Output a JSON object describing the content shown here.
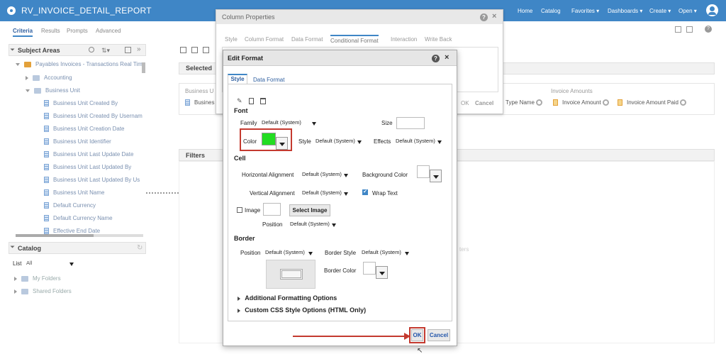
{
  "app": {
    "title": "RV_INVOICE_DETAIL_REPORT"
  },
  "nav": {
    "home": "Home",
    "catalog": "Catalog",
    "favorites": "Favorites",
    "dashboards": "Dashboards",
    "create": "Create",
    "open": "Open"
  },
  "tabs": [
    "Criteria",
    "Results",
    "Prompts",
    "Advanced"
  ],
  "subject_areas": {
    "title": "Subject Areas",
    "root": "Payables Invoices - Transactions Real Tim",
    "items": [
      {
        "label": "Accounting",
        "type": "folder"
      },
      {
        "label": "Business Unit",
        "type": "folder-open"
      },
      {
        "label": "Business Unit Created By",
        "type": "column"
      },
      {
        "label": "Business Unit Created By Usernam",
        "type": "column"
      },
      {
        "label": "Business Unit Creation Date",
        "type": "column"
      },
      {
        "label": "Business Unit Identifier",
        "type": "column"
      },
      {
        "label": "Business Unit Last Update Date",
        "type": "column"
      },
      {
        "label": "Business Unit Last Updated By",
        "type": "column"
      },
      {
        "label": "Business Unit Last Updated By Us",
        "type": "column"
      },
      {
        "label": "Business Unit Name",
        "type": "column"
      },
      {
        "label": "Default Currency",
        "type": "column"
      },
      {
        "label": "Default Currency Name",
        "type": "column"
      },
      {
        "label": "Effective End Date",
        "type": "column"
      }
    ]
  },
  "catalog": {
    "title": "Catalog",
    "list_label": "List",
    "list_value": "All",
    "folders": [
      "My Folders",
      "Shared Folders"
    ]
  },
  "selected_columns": {
    "title": "Selected",
    "group_left": "Business U",
    "pill_left": "Busines",
    "group_right": "Invoice Amounts",
    "pills": [
      "Type Name",
      "Invoice Amount",
      "Invoice Amount Paid"
    ]
  },
  "filters": {
    "title": "Filters",
    "hint_fragment": "ters"
  },
  "column_properties": {
    "title": "Column Properties",
    "tabs": [
      "Style",
      "Column Format",
      "Data Format",
      "Conditional Format",
      "Interaction",
      "Write Back"
    ],
    "active_tab": "Conditional Format",
    "ok": "OK",
    "cancel": "Cancel"
  },
  "edit_format": {
    "title": "Edit Format",
    "tabs": [
      "Style",
      "Data Format"
    ],
    "font": {
      "section": "Font",
      "family_label": "Family",
      "family_value": "Default (System)",
      "size_label": "Size",
      "color_label": "Color",
      "color_value": "#22dd22",
      "style_label": "Style",
      "style_value": "Default (System)",
      "effects_label": "Effects",
      "effects_value": "Default (System)"
    },
    "cell": {
      "section": "Cell",
      "halign_label": "Horizontal Alignment",
      "halign_value": "Default (System)",
      "bg_label": "Background Color",
      "valign_label": "Vertical Alignment",
      "valign_value": "Default (System)",
      "wrap_label": "Wrap Text",
      "wrap_checked": true,
      "image_label": "Image",
      "select_image": "Select Image",
      "position_label": "Position",
      "position_value": "Default (System)"
    },
    "border": {
      "section": "Border",
      "position_label": "Position",
      "position_value": "Default (System)",
      "style_label": "Border Style",
      "style_value": "Default (System)",
      "color_label": "Border Color"
    },
    "additional": "Additional Formatting Options",
    "custom_css": "Custom CSS Style Options (HTML Only)",
    "ok": "OK",
    "cancel": "Cancel"
  },
  "colors": {
    "accent": "#3f86c6",
    "highlight": "#c43a2f"
  }
}
